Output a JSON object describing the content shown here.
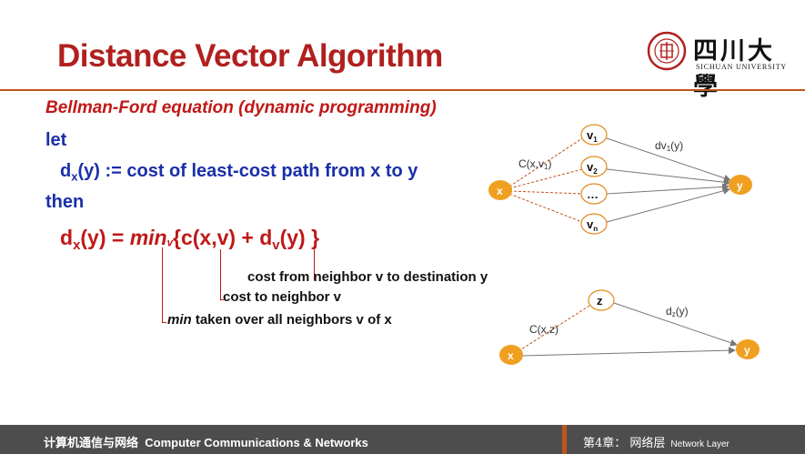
{
  "slide": {
    "title": "Distance Vector Algorithm",
    "logo": {
      "name_cn": "四川大學",
      "name_en": "SICHUAN UNIVERSITY"
    },
    "bellman_label": "Bellman-Ford equation (dynamic programming)",
    "let_label": "let",
    "definition": {
      "lhs": "d",
      "lhs_sub": "x",
      "rhs": "(y) := cost of least-cost path from x to y"
    },
    "then_label": "then",
    "equation": {
      "d": "d",
      "d_sub": "x",
      "y1": "(y) = ",
      "min": "min",
      "min_sub": "v",
      "body": "{c(x,v) + d",
      "dv_sub": "v",
      "end": "(y) }"
    },
    "annotations": {
      "dest": "cost from neighbor v to destination y",
      "neighbor": "cost to neighbor v",
      "min_word": "min",
      "min_rest": " taken over all neighbors v of x"
    },
    "diagram1": {
      "source": "x",
      "dest": "y",
      "neighbors": [
        {
          "label": "v",
          "sub": "1"
        },
        {
          "label": "v",
          "sub": "2"
        },
        {
          "label": "…",
          "sub": ""
        },
        {
          "label": "v",
          "sub": "n"
        }
      ],
      "edge_cost_label": "C(x,v",
      "edge_cost_sub": "1",
      "edge_cost_end": ")",
      "dv_label": "dv",
      "dv_sub": "1",
      "dv_end": "(y)"
    },
    "diagram2": {
      "source": "x",
      "mid": "z",
      "dest": "y",
      "edge_cost_label": "C(x,z)",
      "dz_label": "d",
      "dz_sub": "z",
      "dz_end": "(y)"
    },
    "colors": {
      "title": "#b0201f",
      "accent": "#c0541e",
      "node_fill": "#f0a020",
      "blue_text": "#1a2fa8",
      "red_text": "#c01818",
      "footer": "#4d4d4d"
    }
  },
  "footer": {
    "left_cn": "计算机通信与网络",
    "left_en": "Computer Communications & Networks",
    "right_cn": "第4章： 网络层",
    "right_en": "Network Layer"
  }
}
